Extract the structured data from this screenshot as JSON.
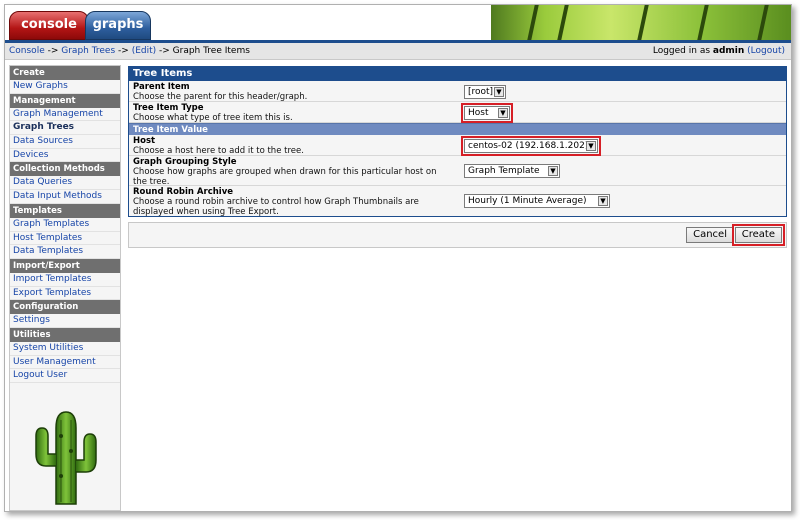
{
  "tabs": [
    {
      "label": "console"
    },
    {
      "label": "graphs"
    }
  ],
  "breadcrumb": {
    "items": [
      "Console",
      "Graph Trees",
      "(Edit)",
      "Graph Tree Items"
    ],
    "separator": " -> "
  },
  "login": {
    "prefix": "Logged in as ",
    "user": "admin",
    "logout": "(Logout)"
  },
  "sidebar": {
    "sections": [
      {
        "header": "Create",
        "items": [
          {
            "label": "New Graphs"
          }
        ]
      },
      {
        "header": "Management",
        "items": [
          {
            "label": "Graph Management"
          },
          {
            "label": "Graph Trees",
            "active": true
          },
          {
            "label": "Data Sources"
          },
          {
            "label": "Devices"
          }
        ]
      },
      {
        "header": "Collection Methods",
        "items": [
          {
            "label": "Data Queries"
          },
          {
            "label": "Data Input Methods"
          }
        ]
      },
      {
        "header": "Templates",
        "items": [
          {
            "label": "Graph Templates"
          },
          {
            "label": "Host Templates"
          },
          {
            "label": "Data Templates"
          }
        ]
      },
      {
        "header": "Import/Export",
        "items": [
          {
            "label": "Import Templates"
          },
          {
            "label": "Export Templates"
          }
        ]
      },
      {
        "header": "Configuration",
        "items": [
          {
            "label": "Settings"
          }
        ]
      },
      {
        "header": "Utilities",
        "items": [
          {
            "label": "System Utilities"
          },
          {
            "label": "User Management"
          },
          {
            "label": "Logout User"
          }
        ]
      }
    ]
  },
  "form": {
    "title": "Tree Items",
    "parent_item": {
      "title": "Parent Item",
      "desc": "Choose the parent for this header/graph.",
      "value": "[root]"
    },
    "tree_item_type": {
      "title": "Tree Item Type",
      "desc": "Choose what type of tree item this is.",
      "value": "Host"
    },
    "sub_header": "Tree Item Value",
    "host": {
      "title": "Host",
      "desc": "Choose a host here to add it to the tree.",
      "value": "centos-02 (192.168.1.202)"
    },
    "grouping": {
      "title": "Graph Grouping Style",
      "desc": "Choose how graphs are grouped when drawn for this particular host on the tree.",
      "value": "Graph Template"
    },
    "rra": {
      "title": "Round Robin Archive",
      "desc": "Choose a round robin archive to control how Graph Thumbnails are displayed when using Tree Export.",
      "value": "Hourly (1 Minute Average)"
    }
  },
  "buttons": {
    "cancel": "Cancel",
    "create": "Create"
  },
  "colors": {
    "accent": "#1d4d8d",
    "highlight": "#d61f26"
  }
}
